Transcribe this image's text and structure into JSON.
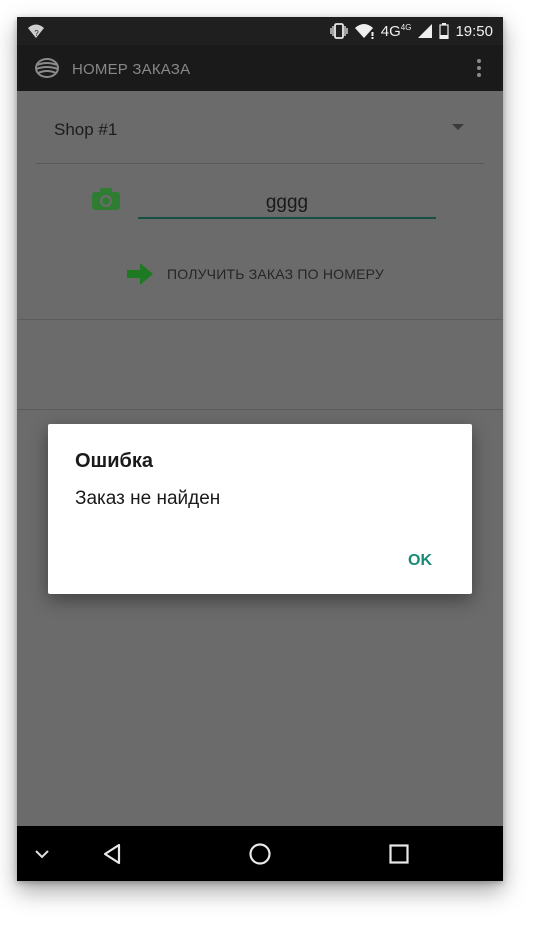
{
  "status_bar": {
    "time": "19:50",
    "network_type": "4G",
    "network_type_sup": "4G",
    "icons": [
      "wifi-unknown-icon",
      "vibrate-icon",
      "wifi-icon",
      "signal-icon",
      "battery-icon"
    ]
  },
  "app_bar": {
    "title": "НОМЕР ЗАКАЗА",
    "logo_icon": "app-logo-icon",
    "menu_icon": "overflow-menu-icon"
  },
  "form": {
    "shop_select": {
      "selected": "Shop #1"
    },
    "order_input": {
      "value": "gggg"
    },
    "camera_icon": "camera-icon",
    "fetch_button": {
      "label": "ПОЛУЧИТЬ ЗАКАЗ ПО НОМЕРУ",
      "icon": "arrow-right-icon"
    }
  },
  "dialog": {
    "title": "Ошибка",
    "message": "Заказ не найден",
    "ok_label": "OK"
  },
  "nav_bar": {
    "icons": [
      "chevron-down-icon",
      "back-icon",
      "home-icon",
      "recents-icon"
    ]
  },
  "colors": {
    "accent": "#188a76",
    "icon_green": "#2e7d32",
    "scrim": "#6b6b6b",
    "app_bar": "#1a1a1a"
  }
}
